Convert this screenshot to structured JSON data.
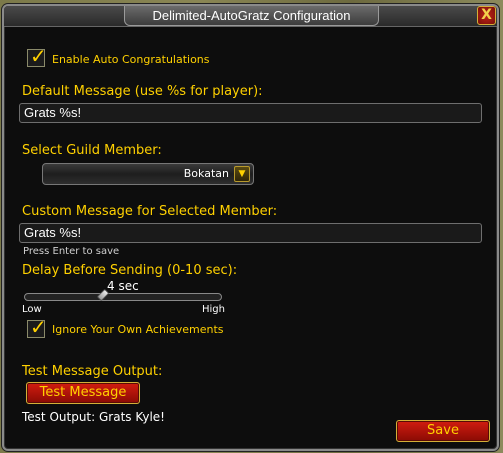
{
  "window": {
    "title": "Delimited-AutoGratz Configuration",
    "close_glyph": "X"
  },
  "enable": {
    "label": "Enable Auto Congratulations",
    "checked": true
  },
  "default_message": {
    "label": "Default Message (use %s for player):",
    "value": "Grats %s!"
  },
  "guild_member": {
    "label": "Select Guild Member:",
    "selected": "Bokatan"
  },
  "custom_message": {
    "label": "Custom Message for Selected Member:",
    "value": "Grats %s!",
    "hint": "Press Enter to save"
  },
  "delay": {
    "label": "Delay Before Sending (0-10 sec):",
    "value_text": "4 sec",
    "value": 4,
    "min": 0,
    "max": 10,
    "low_label": "Low",
    "high_label": "High"
  },
  "ignore_own": {
    "label": "Ignore Your Own Achievements",
    "checked": true
  },
  "test": {
    "section_label": "Test Message Output:",
    "button_label": "Test Message",
    "output_text": "Test Output: Grats Kyle!"
  },
  "save_label": "Save",
  "colors": {
    "gold": "#ffd100",
    "button_red": "#b0150b",
    "panel_bg": "#0d0d0d"
  }
}
